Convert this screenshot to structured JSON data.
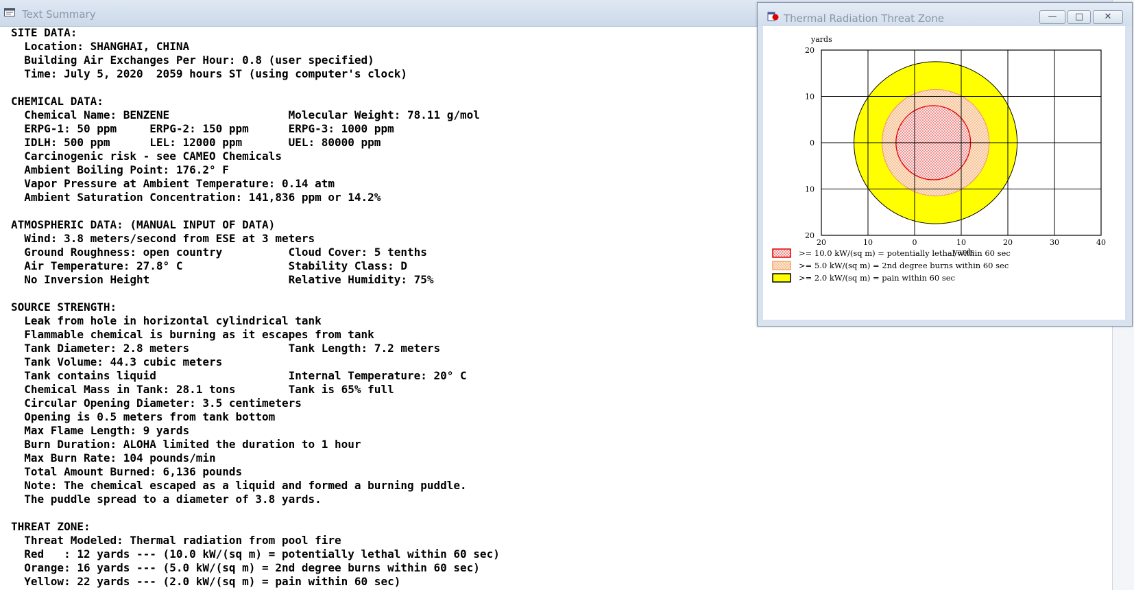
{
  "text_window": {
    "title": "Text Summary",
    "lines": [
      "SITE DATA:",
      "  Location: SHANGHAI, CHINA",
      "  Building Air Exchanges Per Hour: 0.8 (user specified)",
      "  Time: July 5, 2020  2059 hours ST (using computer's clock)",
      "",
      "CHEMICAL DATA:",
      "  Chemical Name: BENZENE                  Molecular Weight: 78.11 g/mol",
      "  ERPG-1: 50 ppm     ERPG-2: 150 ppm      ERPG-3: 1000 ppm",
      "  IDLH: 500 ppm      LEL: 12000 ppm       UEL: 80000 ppm",
      "  Carcinogenic risk - see CAMEO Chemicals",
      "  Ambient Boiling Point: 176.2° F",
      "  Vapor Pressure at Ambient Temperature: 0.14 atm",
      "  Ambient Saturation Concentration: 141,836 ppm or 14.2%",
      "",
      "ATMOSPHERIC DATA: (MANUAL INPUT OF DATA)",
      "  Wind: 3.8 meters/second from ESE at 3 meters",
      "  Ground Roughness: open country          Cloud Cover: 5 tenths",
      "  Air Temperature: 27.8° C                Stability Class: D",
      "  No Inversion Height                     Relative Humidity: 75%",
      "",
      "SOURCE STRENGTH:",
      "  Leak from hole in horizontal cylindrical tank",
      "  Flammable chemical is burning as it escapes from tank",
      "  Tank Diameter: 2.8 meters               Tank Length: 7.2 meters",
      "  Tank Volume: 44.3 cubic meters",
      "  Tank contains liquid                    Internal Temperature: 20° C",
      "  Chemical Mass in Tank: 28.1 tons        Tank is 65% full",
      "  Circular Opening Diameter: 3.5 centimeters",
      "  Opening is 0.5 meters from tank bottom",
      "  Max Flame Length: 9 yards",
      "  Burn Duration: ALOHA limited the duration to 1 hour",
      "  Max Burn Rate: 104 pounds/min",
      "  Total Amount Burned: 6,136 pounds",
      "  Note: The chemical escaped as a liquid and formed a burning puddle.",
      "  The puddle spread to a diameter of 3.8 yards.",
      "",
      "THREAT ZONE:",
      "  Threat Modeled: Thermal radiation from pool fire",
      "  Red   : 12 yards --- (10.0 kW/(sq m) = potentially lethal within 60 sec)",
      "  Orange: 16 yards --- (5.0 kW/(sq m) = 2nd degree burns within 60 sec)",
      "  Yellow: 22 yards --- (2.0 kW/(sq m) = pain within 60 sec)"
    ]
  },
  "threat_window": {
    "title": "Thermal Radiation Threat Zone",
    "buttons": {
      "minimize": "—",
      "maximize": "□",
      "close": "✕"
    },
    "icons": {
      "app_icon": "aloha-app-icon"
    }
  },
  "chart_data": {
    "type": "area",
    "y_unit_label": "yards",
    "x_unit_label": "yards",
    "x_ticks": [
      "20",
      "10",
      "0",
      "10",
      "20",
      "30",
      "40"
    ],
    "y_ticks": [
      "20",
      "10",
      "0",
      "10",
      "20"
    ],
    "xlim": [
      -20,
      40
    ],
    "ylim": [
      -20,
      20
    ],
    "grid": true,
    "zones": [
      {
        "name": "Yellow",
        "center": [
          4.5,
          0
        ],
        "radius": 17.5,
        "fill": "#ffff00",
        "stroke": "#000000",
        "pattern": "solid"
      },
      {
        "name": "Orange",
        "center": [
          4.5,
          0
        ],
        "radius": 11.5,
        "fill": "#fde2c8",
        "stroke": "#f4a46a",
        "pattern": "dots-orange"
      },
      {
        "name": "Red",
        "center": [
          4.0,
          0
        ],
        "radius": 8.0,
        "fill": "#fde4e4",
        "stroke": "#e00000",
        "pattern": "dots-red"
      }
    ],
    "legend": [
      {
        "label": ">= 10.0 kW/(sq m) = potentially lethal within 60 sec",
        "color": "#ff0000",
        "pattern": "dots-red"
      },
      {
        "label": ">= 5.0 kW/(sq m) = 2nd degree burns within 60 sec",
        "color": "#f4a46a",
        "pattern": "dots-orange"
      },
      {
        "label": ">= 2.0 kW/(sq m) = pain within 60 sec",
        "color": "#ffff00",
        "pattern": "solid"
      }
    ],
    "legend_position": "bottom-left"
  },
  "colors": {
    "titlebar_text": "#8a96a6",
    "text": "#000000"
  }
}
